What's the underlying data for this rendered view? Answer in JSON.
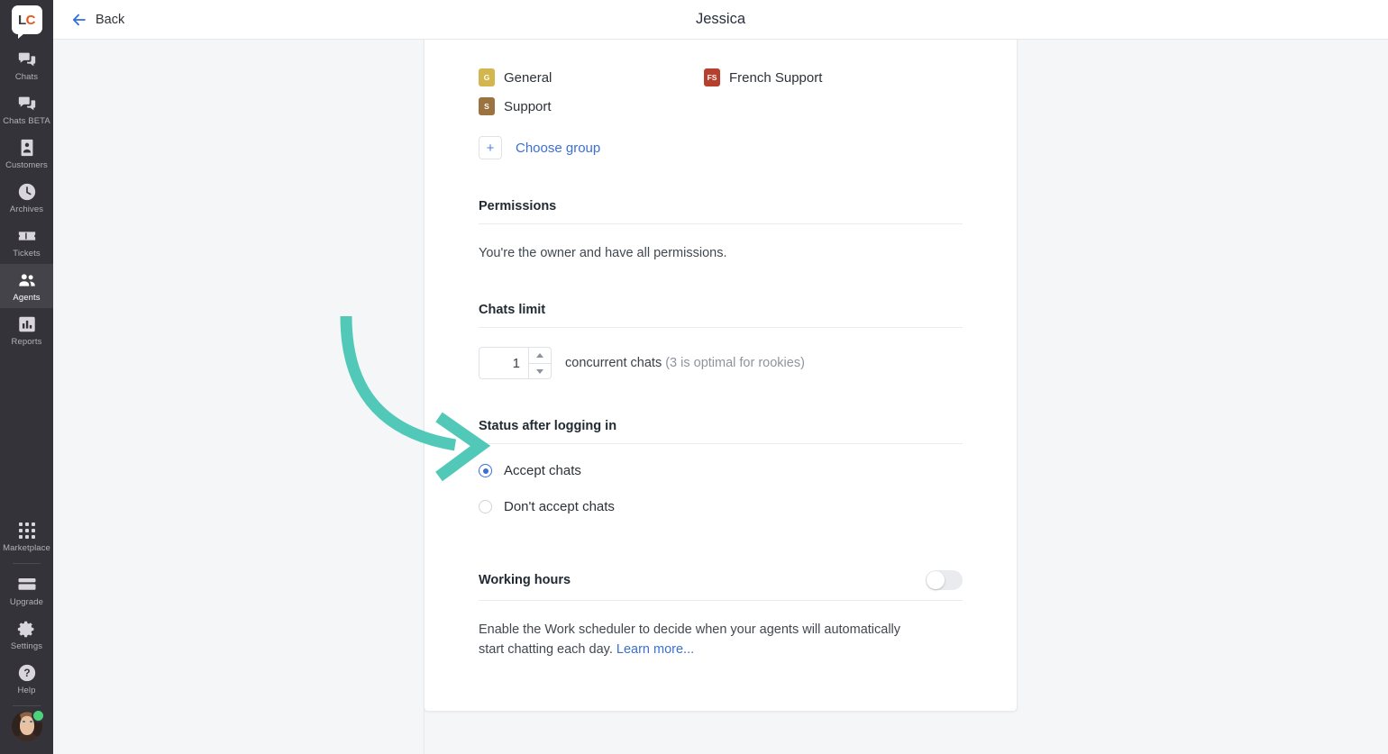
{
  "sidebar": {
    "logo": {
      "name": "livechat-logo",
      "left": "L",
      "right": "C"
    },
    "items": [
      {
        "label": "Chats",
        "icon": "chats-icon",
        "active": false
      },
      {
        "label": "Chats BETA",
        "icon": "chats-beta-icon",
        "active": false
      },
      {
        "label": "Customers",
        "icon": "customers-icon",
        "active": false
      },
      {
        "label": "Archives",
        "icon": "archives-icon",
        "active": false
      },
      {
        "label": "Tickets",
        "icon": "tickets-icon",
        "active": false
      },
      {
        "label": "Agents",
        "icon": "agents-icon",
        "active": true
      },
      {
        "label": "Reports",
        "icon": "reports-icon",
        "active": false
      }
    ],
    "bottom_items": [
      {
        "label": "Marketplace",
        "icon": "marketplace-icon"
      },
      {
        "label": "Upgrade",
        "icon": "upgrade-icon"
      },
      {
        "label": "Settings",
        "icon": "gear-icon"
      },
      {
        "label": "Help",
        "icon": "help-icon"
      }
    ],
    "avatar": {
      "name": "user-avatar",
      "status": "online"
    }
  },
  "header": {
    "back_label": "Back",
    "title": "Jessica"
  },
  "groups": {
    "items": [
      {
        "initials": "G",
        "name": "General",
        "color": "#d4b64e"
      },
      {
        "initials": "FS",
        "name": "French Support",
        "color": "#b73f2e"
      },
      {
        "initials": "S",
        "name": "Support",
        "color": "#9b7340"
      }
    ],
    "add_button": "+",
    "add_label": "Choose group"
  },
  "permissions": {
    "title": "Permissions",
    "text": "You're the owner and have all permissions."
  },
  "chats_limit": {
    "title": "Chats limit",
    "value": "1",
    "unit_label": "concurrent chats",
    "hint": "(3 is optimal for rookies)"
  },
  "status_after_login": {
    "title": "Status after logging in",
    "options": [
      {
        "label": "Accept chats",
        "selected": true
      },
      {
        "label": "Don't accept chats",
        "selected": false
      }
    ]
  },
  "working_hours": {
    "title": "Working hours",
    "toggle_on": false,
    "description": "Enable the Work scheduler to decide when your agents will automatically start chatting each day.",
    "link_label": "Learn more..."
  },
  "annotation": {
    "type": "curved-arrow",
    "color": "#52c9b8",
    "points_to": "Accept chats"
  },
  "colors": {
    "accent_blue": "#3b6fd4",
    "sidebar_bg": "#35333a",
    "page_bg": "#f5f6f8",
    "card_bg": "#ffffff",
    "annotation_green": "#52c9b8",
    "status_online": "#4bd37b"
  }
}
